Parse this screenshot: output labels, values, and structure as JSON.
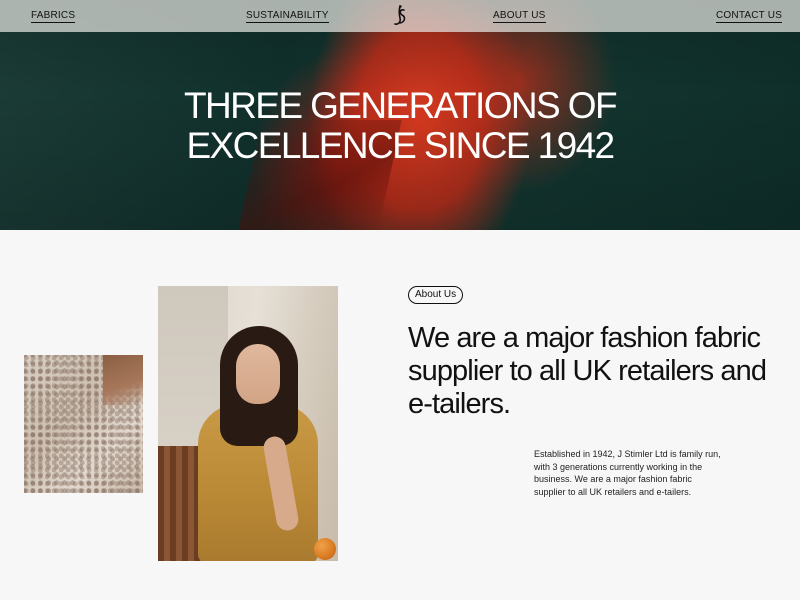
{
  "nav": {
    "items": [
      {
        "label": "FABRICS"
      },
      {
        "label": "SUSTAINABILITY"
      },
      {
        "label": "ABOUT US"
      },
      {
        "label": "CONTACT US"
      }
    ],
    "logo_icon": "js-monogram-icon"
  },
  "hero": {
    "title_line1": "THREE GENERATIONS OF",
    "title_line2": "EXCELLENCE SINCE 1942"
  },
  "about": {
    "pill_label": "About Us",
    "headline": "We are a major fashion fabric supplier to all UK retailers and e-tailers.",
    "body": "Established in 1942, J Stimler Ltd is family run, with 3 generations currently working in the business. We are a major fashion fabric supplier to all UK retailers and e-tailers."
  },
  "colors": {
    "accent_red": "#e23a1e",
    "hero_green": "#10302c",
    "page_bg": "#f7f7f7",
    "text": "#111111"
  }
}
